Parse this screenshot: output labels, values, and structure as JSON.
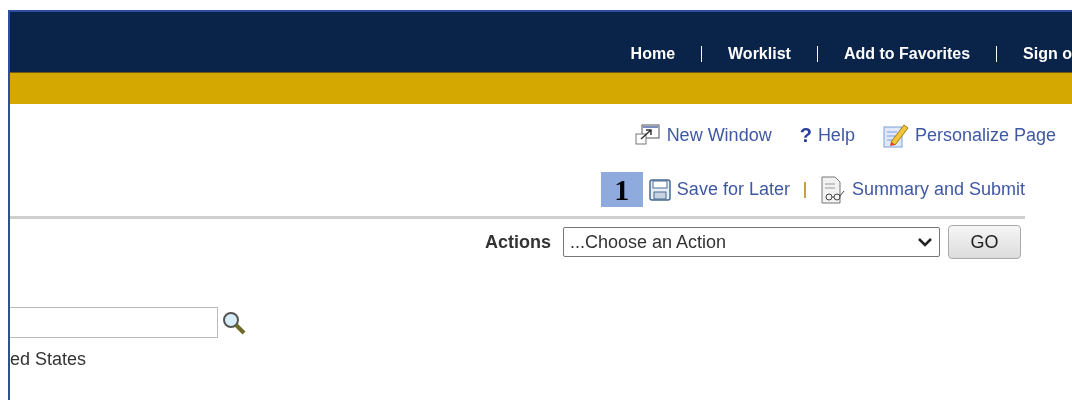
{
  "nav_links": [
    "Home",
    "Worklist",
    "Add to Favorites",
    "Sign o"
  ],
  "page_tools": {
    "new_window": "New Window",
    "help_icon": "?",
    "help": "Help",
    "personalize": "Personalize Page"
  },
  "step_badge": "1",
  "save_for_later": "Save for Later",
  "summary_and_submit": "Summary and Submit",
  "actions": {
    "label": "Actions",
    "selected_option": "...Choose an Action",
    "go_button": "GO"
  },
  "country_text": "ed States"
}
